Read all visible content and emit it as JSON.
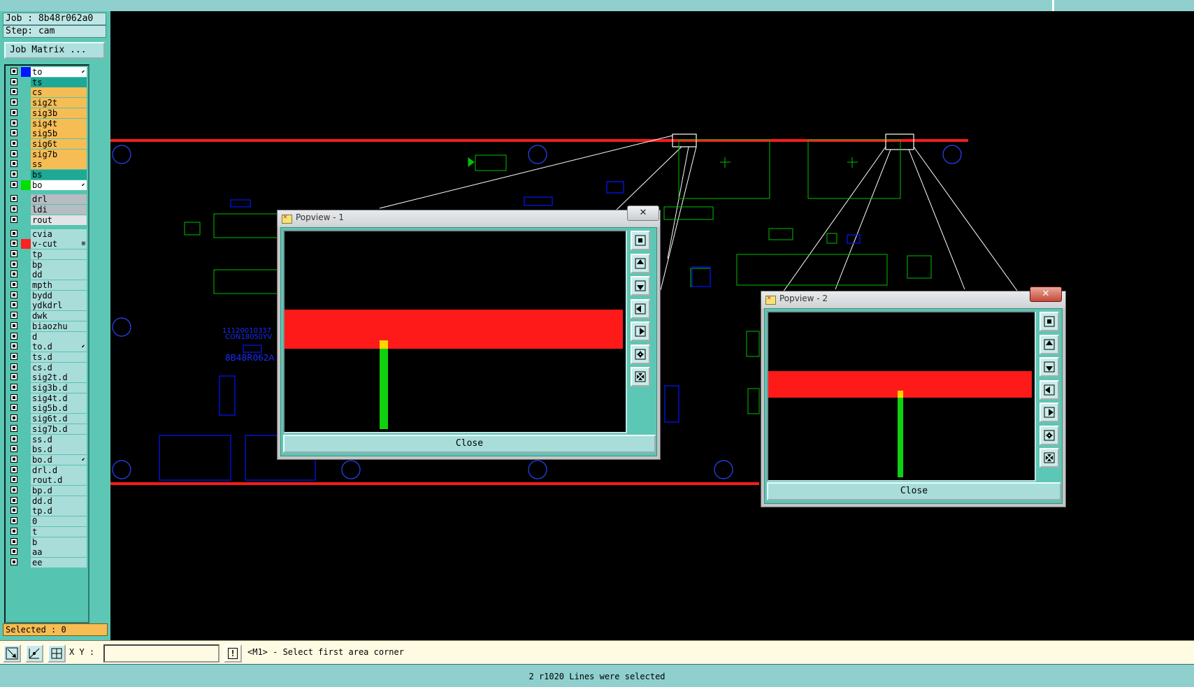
{
  "job_label": "Job : 8b48r062a0",
  "step_label": "Step: cam",
  "job_matrix_button": "Job Matrix ...",
  "layers": [
    {
      "name": "to",
      "swatch": "#0018ff",
      "bg": "#ffffff",
      "mark": "⬋"
    },
    {
      "name": "ts",
      "swatch": "",
      "bg": "#1ea895",
      "mark": ""
    },
    {
      "name": "cs",
      "swatch": "",
      "bg": "#f6bd55",
      "mark": ""
    },
    {
      "name": "sig2t",
      "swatch": "",
      "bg": "#f6bd55",
      "mark": ""
    },
    {
      "name": "sig3b",
      "swatch": "",
      "bg": "#f6bd55",
      "mark": ""
    },
    {
      "name": "sig4t",
      "swatch": "",
      "bg": "#f6bd55",
      "mark": ""
    },
    {
      "name": "sig5b",
      "swatch": "",
      "bg": "#f6bd55",
      "mark": ""
    },
    {
      "name": "sig6t",
      "swatch": "",
      "bg": "#f6bd55",
      "mark": ""
    },
    {
      "name": "sig7b",
      "swatch": "",
      "bg": "#f6bd55",
      "mark": ""
    },
    {
      "name": "ss",
      "swatch": "",
      "bg": "#f6bd55",
      "mark": ""
    },
    {
      "name": "bs",
      "swatch": "",
      "bg": "#1ea895",
      "mark": ""
    },
    {
      "name": "bo",
      "swatch": "#00e000",
      "bg": "#ffffff",
      "mark": "⬋"
    },
    {
      "name": "drl",
      "swatch": "",
      "bg": "#b5bcc2",
      "mark": ""
    },
    {
      "name": "ldi",
      "swatch": "",
      "bg": "#b5bcc2",
      "mark": ""
    },
    {
      "name": "rout",
      "swatch": "",
      "bg": "#e2e4e6",
      "mark": ""
    },
    {
      "name": "cvia",
      "swatch": "",
      "bg": "#a9ddda",
      "mark": ""
    },
    {
      "name": "v-cut",
      "swatch": "#ff2020",
      "bg": "#a9ddda",
      "mark": "⊞"
    },
    {
      "name": "tp",
      "swatch": "",
      "bg": "#a9ddda",
      "mark": ""
    },
    {
      "name": "bp",
      "swatch": "",
      "bg": "#a9ddda",
      "mark": ""
    },
    {
      "name": "dd",
      "swatch": "",
      "bg": "#a9ddda",
      "mark": ""
    },
    {
      "name": "mpth",
      "swatch": "",
      "bg": "#a9ddda",
      "mark": ""
    },
    {
      "name": "bydd",
      "swatch": "",
      "bg": "#a9ddda",
      "mark": ""
    },
    {
      "name": "ydkdrl",
      "swatch": "",
      "bg": "#a9ddda",
      "mark": ""
    },
    {
      "name": "dwk",
      "swatch": "",
      "bg": "#a9ddda",
      "mark": ""
    },
    {
      "name": "biaozhu",
      "swatch": "",
      "bg": "#a9ddda",
      "mark": ""
    },
    {
      "name": "d",
      "swatch": "",
      "bg": "#a9ddda",
      "mark": ""
    },
    {
      "name": "to.d",
      "swatch": "",
      "bg": "#a9ddda",
      "mark": "⬋"
    },
    {
      "name": "ts.d",
      "swatch": "",
      "bg": "#a9ddda",
      "mark": ""
    },
    {
      "name": "cs.d",
      "swatch": "",
      "bg": "#a9ddda",
      "mark": ""
    },
    {
      "name": "sig2t.d",
      "swatch": "",
      "bg": "#a9ddda",
      "mark": ""
    },
    {
      "name": "sig3b.d",
      "swatch": "",
      "bg": "#a9ddda",
      "mark": ""
    },
    {
      "name": "sig4t.d",
      "swatch": "",
      "bg": "#a9ddda",
      "mark": ""
    },
    {
      "name": "sig5b.d",
      "swatch": "",
      "bg": "#a9ddda",
      "mark": ""
    },
    {
      "name": "sig6t.d",
      "swatch": "",
      "bg": "#a9ddda",
      "mark": ""
    },
    {
      "name": "sig7b.d",
      "swatch": "",
      "bg": "#a9ddda",
      "mark": ""
    },
    {
      "name": "ss.d",
      "swatch": "",
      "bg": "#a9ddda",
      "mark": ""
    },
    {
      "name": "bs.d",
      "swatch": "",
      "bg": "#a9ddda",
      "mark": ""
    },
    {
      "name": "bo.d",
      "swatch": "",
      "bg": "#a9ddda",
      "mark": "⬋"
    },
    {
      "name": "drl.d",
      "swatch": "",
      "bg": "#a9ddda",
      "mark": ""
    },
    {
      "name": "rout.d",
      "swatch": "",
      "bg": "#a9ddda",
      "mark": ""
    },
    {
      "name": "bp.d",
      "swatch": "",
      "bg": "#a9ddda",
      "mark": ""
    },
    {
      "name": "dd.d",
      "swatch": "",
      "bg": "#a9ddda",
      "mark": ""
    },
    {
      "name": "tp.d",
      "swatch": "",
      "bg": "#a9ddda",
      "mark": ""
    },
    {
      "name": "0",
      "swatch": "",
      "bg": "#a9ddda",
      "mark": ""
    },
    {
      "name": "t",
      "swatch": "",
      "bg": "#a9ddda",
      "mark": ""
    },
    {
      "name": "b",
      "swatch": "",
      "bg": "#a9ddda",
      "mark": ""
    },
    {
      "name": "aa",
      "swatch": "",
      "bg": "#a9ddda",
      "mark": ""
    },
    {
      "name": "ee",
      "swatch": "",
      "bg": "#a9ddda",
      "mark": ""
    }
  ],
  "selected_label": "Selected : 0",
  "board_text": {
    "part_no": "11120010337",
    "con": "CON18050YV",
    "board_id": "8B48R062A"
  },
  "popview1": {
    "title": "Popview - 1",
    "close_label": "Close",
    "close_x": "✕"
  },
  "popview2": {
    "title": "Popview - 2",
    "close_label": "Close",
    "close_x": "✕"
  },
  "command_bar": {
    "xy_label": "X Y :",
    "xy_value": "",
    "prompt": "<M1> - Select first area corner"
  },
  "status_message": "2 r1020 Lines were selected",
  "colors": {
    "panel": "#5cc7b4",
    "cut_line": "#ff1a1a",
    "signal": "#0018ff",
    "silkscreen": "#00c000",
    "pad": "#ffd400"
  }
}
